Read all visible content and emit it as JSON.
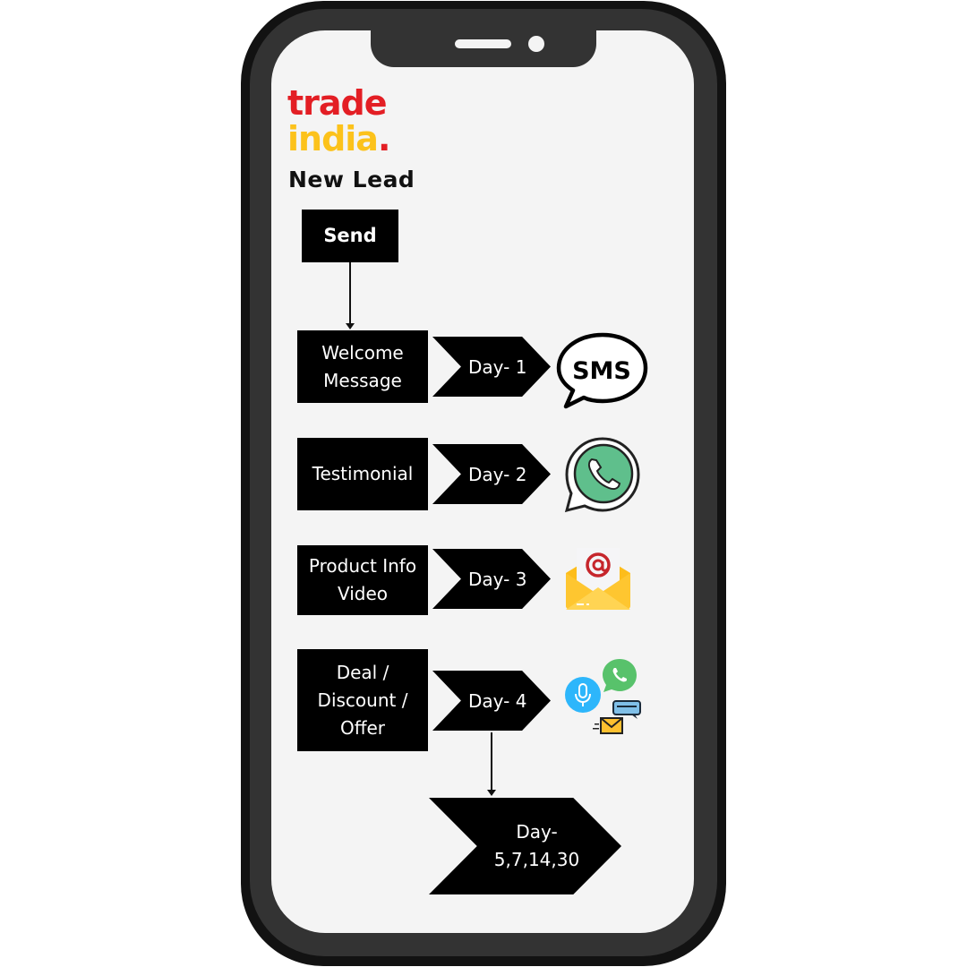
{
  "brand": {
    "logo_line1": "trade",
    "logo_line2": "india",
    "logo_dot": ".",
    "colors": {
      "red": "#e31e24",
      "yellow": "#fcc21b"
    }
  },
  "title": "New Lead",
  "start": {
    "label": "Send"
  },
  "steps": [
    {
      "action": "Welcome Message",
      "action_lines": [
        "Welcome",
        "Message"
      ],
      "day": "Day- 1",
      "channel": "SMS",
      "channel_icon": "sms-bubble-icon"
    },
    {
      "action": "Testimonial",
      "action_lines": [
        "Testimonial"
      ],
      "day": "Day- 2",
      "channel": "WhatsApp",
      "channel_icon": "whatsapp-icon"
    },
    {
      "action": "Product Info Video",
      "action_lines": [
        "Product Info",
        "Video"
      ],
      "day": "Day- 3",
      "channel": "Email",
      "channel_icon": "email-icon"
    },
    {
      "action": "Deal / Discount / Offer",
      "action_lines": [
        "Deal /",
        "Discount /",
        "Offer"
      ],
      "day": "Day- 4",
      "channel": "Multi-channel",
      "channel_icon": "multichannel-icon"
    }
  ],
  "followup": {
    "lines": [
      "Day-",
      "5,7,14,30"
    ]
  },
  "sms_icon_text": "SMS"
}
